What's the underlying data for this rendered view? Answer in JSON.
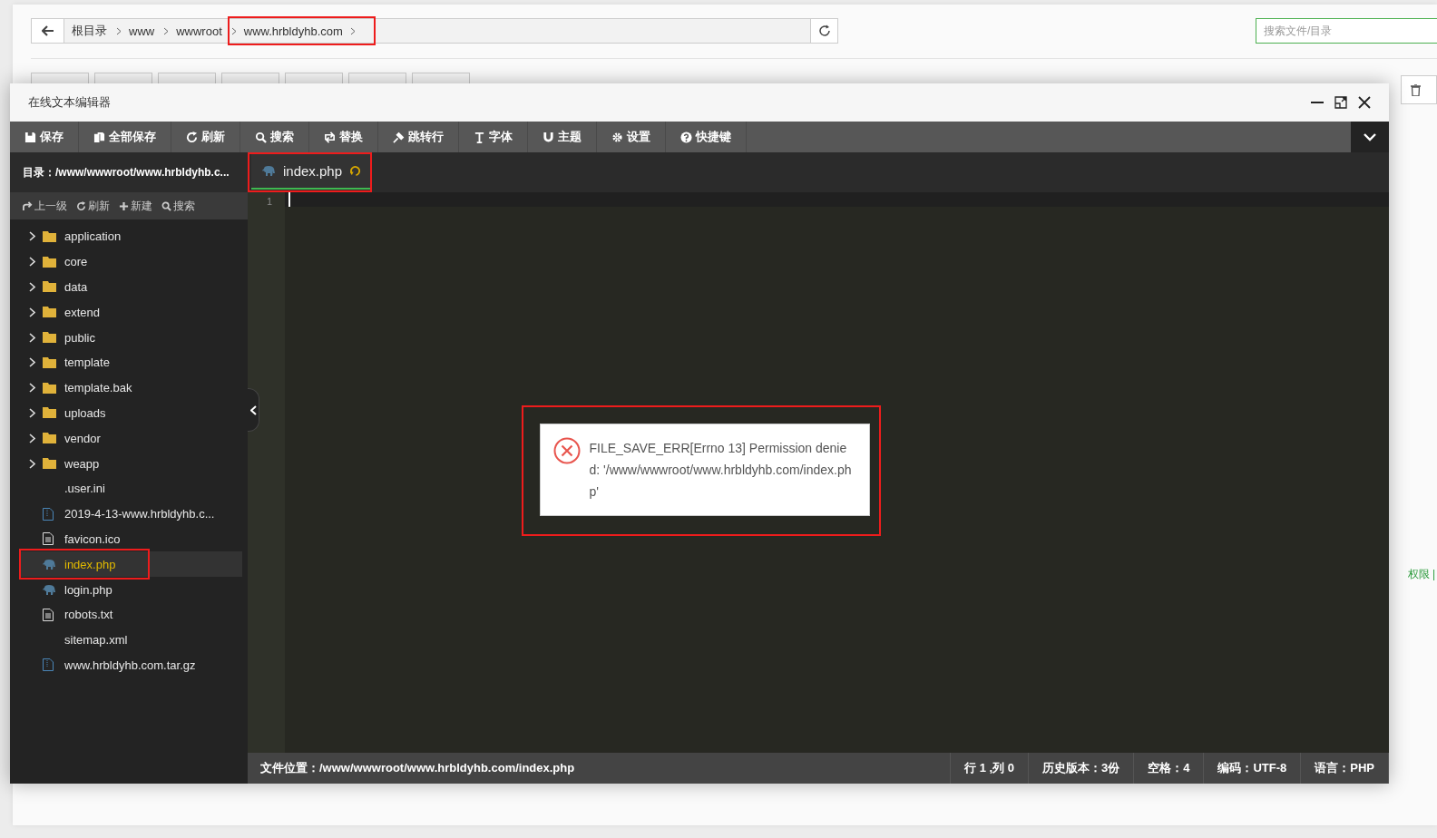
{
  "background_page": {
    "breadcrumb": [
      {
        "label": "根目录",
        "highlighted": false
      },
      {
        "label": "www",
        "highlighted": false
      },
      {
        "label": "wwwroot",
        "highlighted": false
      },
      {
        "label": "www.hrbldyhb.com",
        "highlighted": true
      }
    ],
    "search": {
      "placeholder": "搜索文件/目录"
    },
    "side_link": "权限 |"
  },
  "editor": {
    "title": "在线文本编辑器",
    "toolbar": [
      "保存",
      "全部保存",
      "刷新",
      "搜索",
      "替换",
      "跳转行",
      "字体",
      "主题",
      "设置",
      "快捷键"
    ],
    "directory": "目录：/www/wwwroot/www.hrbldyhb.c...",
    "tabs": [
      {
        "label": "index.php",
        "selected": true,
        "highlighted": true
      }
    ],
    "file_actions": [
      "上一级",
      "刷新",
      "新建",
      "搜索"
    ],
    "files": [
      {
        "name": "application",
        "kind": "folder",
        "selected": false,
        "highlighted": false
      },
      {
        "name": "core",
        "kind": "folder",
        "selected": false,
        "highlighted": false
      },
      {
        "name": "data",
        "kind": "folder",
        "selected": false,
        "highlighted": false
      },
      {
        "name": "extend",
        "kind": "folder",
        "selected": false,
        "highlighted": false
      },
      {
        "name": "public",
        "kind": "folder",
        "selected": false,
        "highlighted": false
      },
      {
        "name": "template",
        "kind": "folder",
        "selected": false,
        "highlighted": false
      },
      {
        "name": "template.bak",
        "kind": "folder",
        "selected": false,
        "highlighted": false
      },
      {
        "name": "uploads",
        "kind": "folder",
        "selected": false,
        "highlighted": false
      },
      {
        "name": "vendor",
        "kind": "folder",
        "selected": false,
        "highlighted": false
      },
      {
        "name": "weapp",
        "kind": "folder",
        "selected": false,
        "highlighted": false
      },
      {
        "name": ".user.ini",
        "kind": "plain",
        "selected": false,
        "highlighted": false
      },
      {
        "name": "2019-4-13-www.hrbldyhb.c...",
        "kind": "archive",
        "selected": false,
        "highlighted": false
      },
      {
        "name": "favicon.ico",
        "kind": "text",
        "selected": false,
        "highlighted": false
      },
      {
        "name": "index.php",
        "kind": "php",
        "selected": true,
        "highlighted": true
      },
      {
        "name": "login.php",
        "kind": "php",
        "selected": false,
        "highlighted": false
      },
      {
        "name": "robots.txt",
        "kind": "text",
        "selected": false,
        "highlighted": false
      },
      {
        "name": "sitemap.xml",
        "kind": "plain",
        "selected": false,
        "highlighted": false
      },
      {
        "name": "www.hrbldyhb.com.tar.gz",
        "kind": "archive",
        "selected": false,
        "highlighted": false
      }
    ],
    "line_numbers": [
      "1"
    ],
    "error": {
      "message": "FILE_SAVE_ERR[Errno 13] Permission denied: '/www/wwwroot/www.hrbldyhb.com/index.php'",
      "highlighted": true
    },
    "status_bar": {
      "path": "文件位置：/www/wwwroot/www.hrbldyhb.com/index.php",
      "items": [
        "行 1 ,列 0",
        "历史版本：3份",
        "空格：4",
        "编码：UTF-8",
        "语言：PHP"
      ]
    }
  }
}
